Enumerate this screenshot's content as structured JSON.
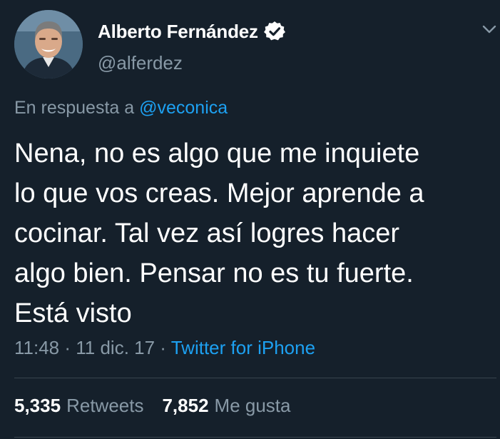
{
  "author": {
    "display_name": "Alberto Fernández",
    "handle": "@alferdez",
    "avatar_icon": "profile-photo",
    "verified_icon": "verified-badge-icon"
  },
  "reply": {
    "prefix": "En respuesta a",
    "target": "@veconica"
  },
  "tweet": {
    "text": "Nena, no es algo que me inquiete\nlo que vos creas. Mejor aprende a\ncocinar. Tal vez así logres hacer\nalgo bien. Pensar no es tu fuerte.\nEstá visto"
  },
  "meta": {
    "time": "11:48",
    "separator": " · ",
    "date": "11 dic. 17",
    "source": "Twitter for iPhone"
  },
  "stats": {
    "retweets_count": "5,335",
    "retweets_label": "Retweets",
    "likes_count": "7,852",
    "likes_label": "Me gusta"
  },
  "colors": {
    "background": "#15202b",
    "primary_text": "#ffffff",
    "secondary_text": "#8899a6",
    "link": "#1da1f2",
    "divider": "#38444d"
  }
}
